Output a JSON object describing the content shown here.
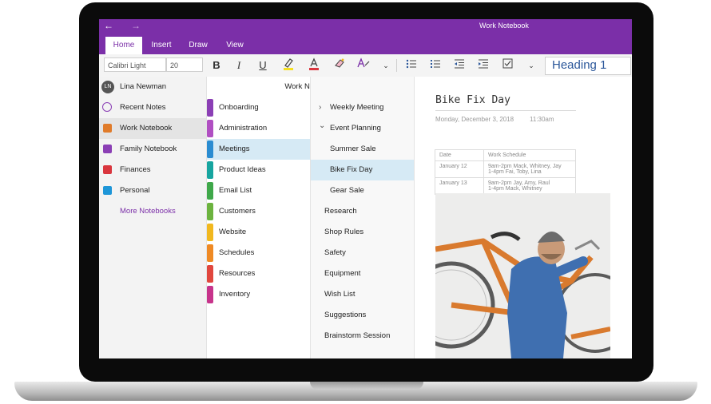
{
  "window": {
    "title": "Work Notebook",
    "back_icon": "back-arrow-icon",
    "forward_icon": "forward-arrow-icon"
  },
  "ribbon": {
    "tabs": [
      "Home",
      "Insert",
      "Draw",
      "View"
    ],
    "active_tab": "Home"
  },
  "toolbar": {
    "font_name": "Calibri Light",
    "font_size": "20",
    "bold": "B",
    "italic": "I",
    "underline": "U",
    "style": "Heading 1",
    "icons": [
      "bold-icon",
      "italic-icon",
      "underline-icon",
      "highlighter-icon",
      "font-color-icon",
      "clear-formatting-icon",
      "text-style-icon",
      "chevron-down-icon",
      "bullets-icon",
      "numbering-icon",
      "outdent-icon",
      "indent-icon",
      "checkbox-icon",
      "chevron-down-icon"
    ]
  },
  "user": {
    "initials": "LN",
    "name": "Lina Newman"
  },
  "notebooks": [
    {
      "label": "Recent Notes",
      "color": "#8b3fb5",
      "icon": "clock-icon"
    },
    {
      "label": "Work Notebook",
      "color": "#e07b2a",
      "icon": "notebook-icon",
      "selected": true
    },
    {
      "label": "Family Notebook",
      "color": "#8b3fb5",
      "icon": "notebook-icon"
    },
    {
      "label": "Finances",
      "color": "#d9363e",
      "icon": "notebook-icon"
    },
    {
      "label": "Personal",
      "color": "#1e96d8",
      "icon": "notebook-icon"
    }
  ],
  "more_notebooks": "More Notebooks",
  "sections": {
    "header": "Work Notebook",
    "search_icon": "search-icon",
    "items": [
      {
        "label": "Onboarding",
        "color": "#8b3fb5"
      },
      {
        "label": "Administration",
        "color": "#b04fc2"
      },
      {
        "label": "Meetings",
        "color": "#2a8cd1",
        "selected": true
      },
      {
        "label": "Product Ideas",
        "color": "#17a5a0"
      },
      {
        "label": "Email List",
        "color": "#3fa84a"
      },
      {
        "label": "Customers",
        "color": "#6cb33f"
      },
      {
        "label": "Website",
        "color": "#f1b81f"
      },
      {
        "label": "Schedules",
        "color": "#ef8a24"
      },
      {
        "label": "Resources",
        "color": "#e1473e"
      },
      {
        "label": "Inventory",
        "color": "#c7348b"
      }
    ]
  },
  "pages": [
    {
      "label": "Weekly Meeting",
      "indent": 1,
      "chevron": "›"
    },
    {
      "label": "Event Planning",
      "indent": 1,
      "chevron": "⌄"
    },
    {
      "label": "Summer Sale",
      "indent": 2
    },
    {
      "label": "Bike Fix Day",
      "indent": 2,
      "selected": true
    },
    {
      "label": "Gear Sale",
      "indent": 2
    },
    {
      "label": "Research",
      "indent": 0
    },
    {
      "label": "Shop Rules",
      "indent": 0
    },
    {
      "label": "Safety",
      "indent": 0
    },
    {
      "label": "Equipment",
      "indent": 0
    },
    {
      "label": "Wish List",
      "indent": 0
    },
    {
      "label": "Suggestions",
      "indent": 0
    },
    {
      "label": "Brainstorm Session",
      "indent": 0
    }
  ],
  "note": {
    "title": "Bike Fix Day",
    "date": "Monday, December 3, 2018",
    "time": "11:30am",
    "table": {
      "headers": [
        "Date",
        "Work Schedule"
      ],
      "rows": [
        [
          "January 12",
          "9am-2pm Mack, Whitney, Jay",
          "1-4pm Fai, Toby, Lina"
        ],
        [
          "January 13",
          "9am-2pm Jay, Amy, Raul",
          "1-4pm Mack, Whitney"
        ]
      ]
    },
    "image_alt": "man-carrying-bicycle-photo"
  },
  "colors": {
    "accent": "#7b2fa8",
    "link": "#7b2fa8",
    "heading": "#2b579a"
  }
}
